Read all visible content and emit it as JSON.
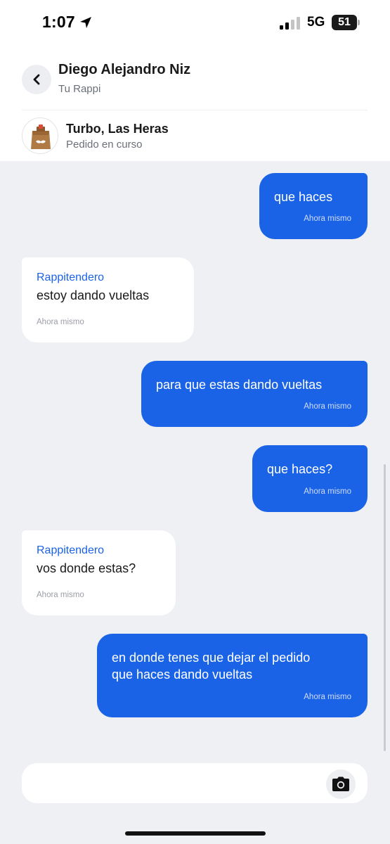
{
  "status_bar": {
    "time": "1:07",
    "network": "5G",
    "battery": "51"
  },
  "header": {
    "contact_name": "Diego Alejandro Niz",
    "subtitle": "Tu Rappi"
  },
  "order": {
    "store_name": "Turbo, Las Heras",
    "status": "Pedido en curso"
  },
  "messages": [
    {
      "direction": "out",
      "text": "que haces",
      "time": "Ahora mismo"
    },
    {
      "direction": "in",
      "sender": "Rappitendero",
      "text": "estoy dando vueltas",
      "time": "Ahora mismo"
    },
    {
      "direction": "out",
      "text": "para que estas dando vueltas",
      "time": "Ahora mismo"
    },
    {
      "direction": "out",
      "text": "que haces?",
      "time": "Ahora mismo"
    },
    {
      "direction": "in",
      "sender": "Rappitendero",
      "text": "vos donde estas?",
      "time": "Ahora mismo"
    },
    {
      "direction": "out",
      "text": "en donde tenes que dejar el pedido\nque haces dando vueltas",
      "time": "Ahora mismo"
    }
  ],
  "icons": {
    "back": "chevron-left-icon",
    "camera": "camera-icon",
    "location": "location-arrow-icon",
    "store": "paper-bag-icon"
  },
  "colors": {
    "accent": "#1a63e6",
    "chat_background": "#eef0f4"
  }
}
